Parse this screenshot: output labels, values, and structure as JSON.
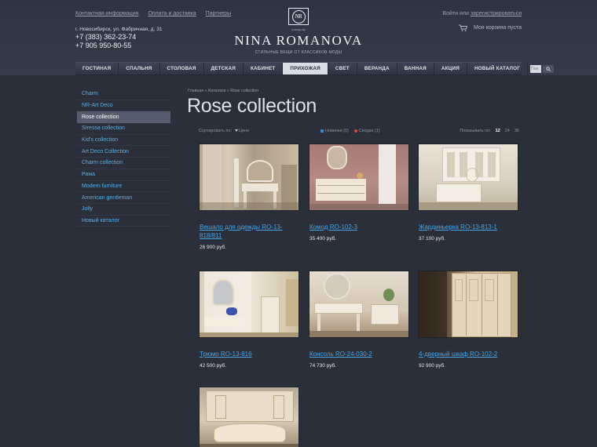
{
  "header": {
    "top_links": [
      "Контактная информация",
      "Оплата и доставка",
      "Партнеры"
    ],
    "address": "г. Новосибирск, ул. Фабричная, д. 31",
    "phones": [
      "+7 (383) 362-23-74",
      "+7 905 950-80-55"
    ],
    "logo": {
      "mark": "NR",
      "luxury": "Luxury by",
      "brand": "NINA ROMANOVA",
      "tagline": "СТИЛЬНЫЕ ВЕЩИ ОТ КЛАССИКОВ МОДЫ"
    },
    "login_text": "Войти или",
    "register_link": "зарегистрироваться",
    "cart_text": "Моя корзина пуста",
    "cart_icon": "cart-icon"
  },
  "nav": {
    "items": [
      "ГОСТИНАЯ",
      "СПАЛЬНЯ",
      "СТОЛОВАЯ",
      "ДЕТСКАЯ",
      "КАБИНЕТ",
      "ПРИХОЖАЯ",
      "СВЕТ",
      "ВЕРАНДА",
      "ВАННАЯ",
      "АКЦИЯ",
      "НОВЫЙ КАТАЛОГ"
    ],
    "active": "ПРИХОЖАЯ",
    "search_placeholder": "Пои",
    "search_icon": "search-icon"
  },
  "sidebar": {
    "items": [
      "Charm",
      "NR-Art Deco",
      "Rose collection",
      "Stressa collection",
      "Kid's collection",
      "Art Deco Collection",
      "Charm collection",
      "Рама",
      "Modern furniture",
      "American gentleman",
      "Jolly",
      "Новый каталог"
    ],
    "active": "Rose collection"
  },
  "main": {
    "breadcrumb": [
      "Главная",
      "Каталоги",
      "Rose collection"
    ],
    "breadcrumb_sep": "»",
    "title": "Rose collection",
    "sort_label": "Сортировать по:",
    "sort_value": "Цене",
    "compare_new": "Новинки (0)",
    "compare_list": "Сводка (1)",
    "per_page_label": "Показывать по:",
    "per_page_options": [
      "12",
      "24",
      "36"
    ],
    "per_page_selected": "12",
    "colors": {
      "link": "#4aa5e6",
      "accent_blue": "#3f86c8",
      "accent_red": "#d8483c"
    }
  },
  "products": [
    {
      "name": "Вешало для одежды RO-13-818/811",
      "price": "26 900 руб."
    },
    {
      "name": "Комод RO-102-3",
      "price": "35 400 руб."
    },
    {
      "name": "Жардиньерка RO-13-813-1",
      "price": "37 100 руб."
    },
    {
      "name": "Трюмо RO-13-816",
      "price": "42 500 руб."
    },
    {
      "name": "Консоль RO-24-030-2",
      "price": "74 730 руб."
    },
    {
      "name": "4-дверный шкаф RO-102-2",
      "price": "92 900 руб."
    },
    {
      "name": "",
      "price": ""
    }
  ]
}
